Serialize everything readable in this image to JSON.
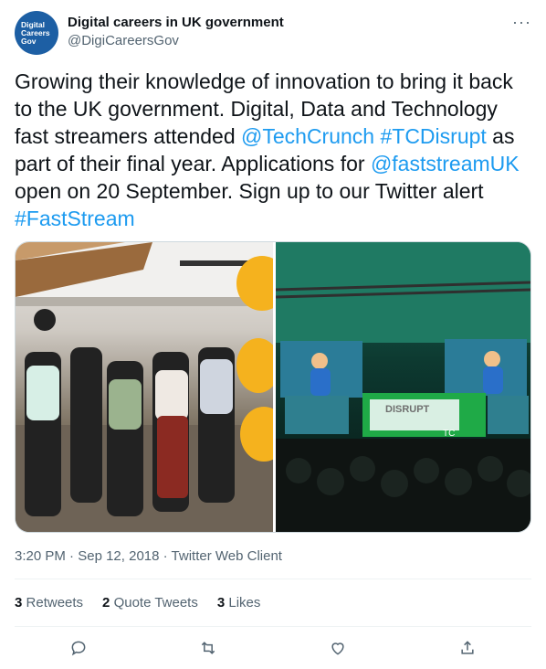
{
  "account": {
    "avatar_text": "Digital\nCareers\nGov",
    "display_name": "Digital careers in UK government",
    "handle": "@DigiCareersGov"
  },
  "tweet": {
    "segments": [
      {
        "text": "Growing their knowledge of innovation to bring it back to the UK government. Digital, Data and Technology fast streamers attended ",
        "type": "text"
      },
      {
        "text": "@TechCrunch",
        "type": "link"
      },
      {
        "text": " ",
        "type": "text"
      },
      {
        "text": "#TCDisrupt",
        "type": "link"
      },
      {
        "text": " as part of their final year. Applications for ",
        "type": "text"
      },
      {
        "text": "@faststreamUK",
        "type": "link"
      },
      {
        "text": " open on 20 September. Sign up to our Twitter alert ",
        "type": "text"
      },
      {
        "text": "#FastStream",
        "type": "link"
      }
    ]
  },
  "media": {
    "image_text": {
      "disrupt_banner": "DISRUPT",
      "stage_logo": "TC"
    }
  },
  "meta": {
    "time": "3:20 PM",
    "date": "Sep 12, 2018",
    "client": "Twitter Web Client",
    "separator": "·"
  },
  "stats": {
    "retweets_count": "3",
    "retweets_label": "Retweets",
    "quotes_count": "2",
    "quotes_label": "Quote Tweets",
    "likes_count": "3",
    "likes_label": "Likes"
  },
  "colors": {
    "link": "#1d9bf0",
    "secondary_text": "#536471",
    "primary_text": "#0f1419",
    "avatar_bg": "#1d5fa4"
  },
  "icons": [
    "more-icon",
    "reply-icon",
    "retweet-icon",
    "like-icon",
    "share-icon"
  ]
}
